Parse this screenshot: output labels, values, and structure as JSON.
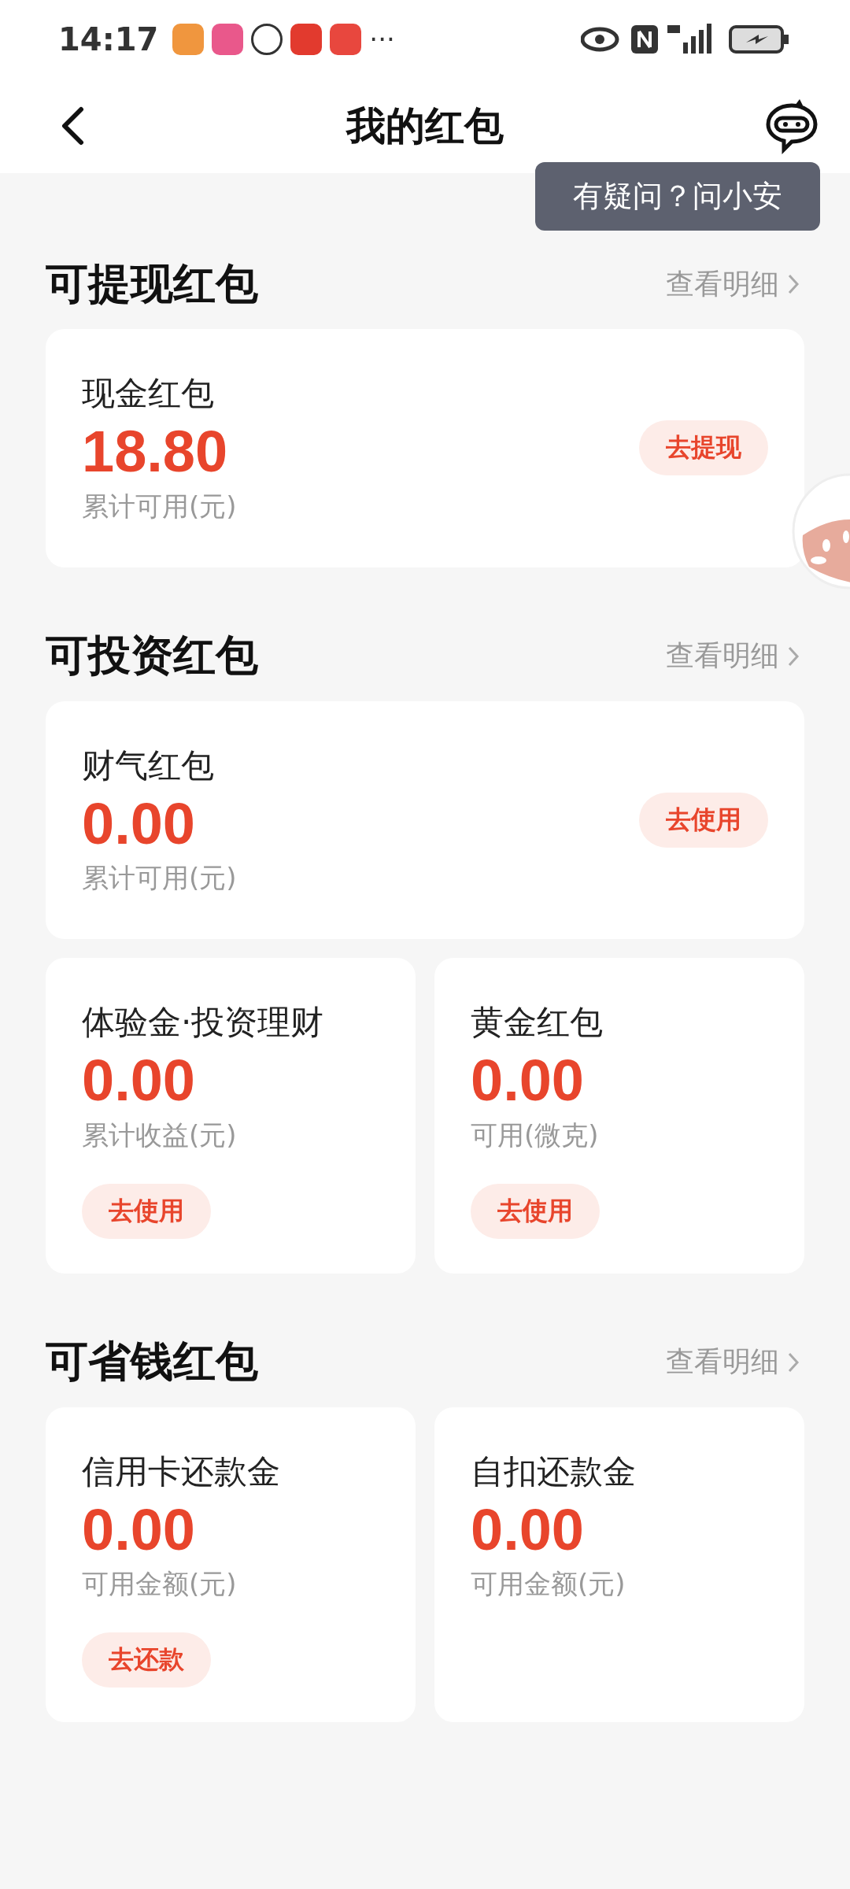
{
  "status_bar": {
    "time": "14:17",
    "more": "···"
  },
  "header": {
    "title": "我的红包",
    "tooltip": "有疑问？问小安"
  },
  "sections": [
    {
      "title": "可提现红包",
      "link": "查看明细",
      "cards": [
        {
          "kind": "wide",
          "name": "现金红包",
          "amount": "18.80",
          "caption": "累计可用(元)",
          "button": "去提现"
        }
      ]
    },
    {
      "title": "可投资红包",
      "link": "查看明细",
      "cards": [
        {
          "kind": "wide",
          "name": "财气红包",
          "amount": "0.00",
          "caption": "累计可用(元)",
          "button": "去使用"
        },
        {
          "kind": "half",
          "name": "体验金·投资理财",
          "amount": "0.00",
          "caption": "累计收益(元)",
          "button": "去使用"
        },
        {
          "kind": "half",
          "name": "黄金红包",
          "amount": "0.00",
          "caption": "可用(微克)",
          "button": "去使用"
        }
      ]
    },
    {
      "title": "可省钱红包",
      "link": "查看明细",
      "cards": [
        {
          "kind": "half",
          "name": "信用卡还款金",
          "amount": "0.00",
          "caption": "可用金额(元)",
          "button": "去还款"
        },
        {
          "kind": "half",
          "name": "自扣还款金",
          "amount": "0.00",
          "caption": "可用金额(元)"
        }
      ]
    }
  ]
}
